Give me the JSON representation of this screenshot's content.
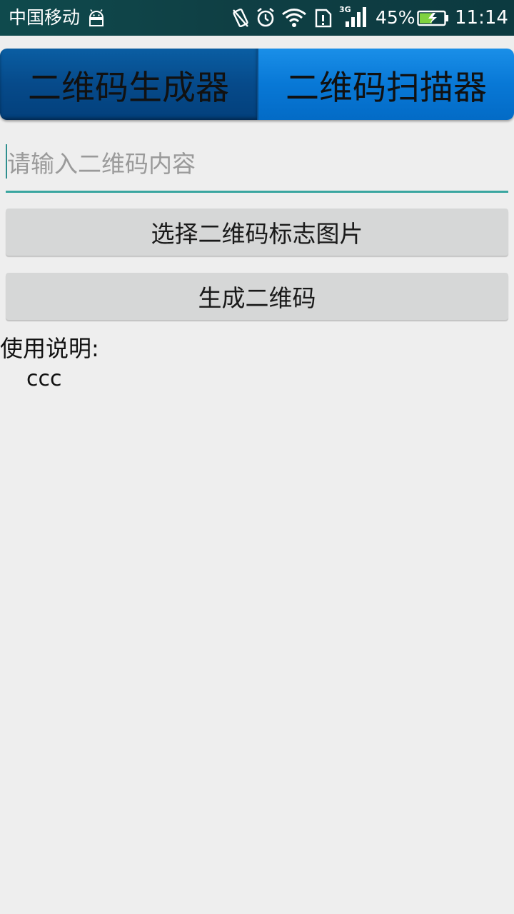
{
  "status_bar": {
    "carrier": "中国移动",
    "network_type": "3G",
    "battery_percent": "45%",
    "time": "11:14",
    "icons": [
      "android-debug-icon",
      "vibrate-icon",
      "alarm-icon",
      "wifi-icon",
      "sim-alert-icon",
      "signal-icon",
      "battery-charging-icon"
    ]
  },
  "tabs": [
    {
      "label": "二维码生成器",
      "selected": true
    },
    {
      "label": "二维码扫描器",
      "selected": false
    }
  ],
  "input": {
    "placeholder": "请输入二维码内容",
    "value": ""
  },
  "buttons": {
    "select_logo": "选择二维码标志图片",
    "generate": "生成二维码"
  },
  "instructions": {
    "label": "使用说明:",
    "text": "ccc"
  },
  "colors": {
    "status_bar": "#0f4a4d",
    "tab_selected": "#064a8a",
    "tab_unselected": "#0878d6",
    "input_underline": "#3aa6a0",
    "button_bg": "#d6d7d7",
    "page_bg": "#eeeeee"
  }
}
